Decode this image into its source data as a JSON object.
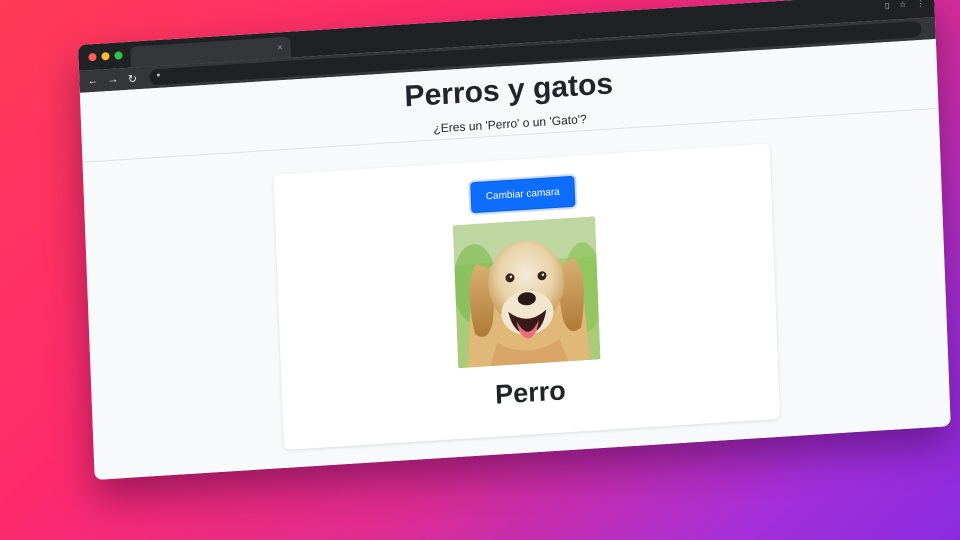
{
  "browser": {
    "tab_close": "×",
    "icons": [
      "back-arrow-icon",
      "forward-arrow-icon",
      "reload-icon",
      "lock-icon",
      "share-icon",
      "star-icon",
      "menu-dots-icon"
    ]
  },
  "page": {
    "title": "Perros y gatos",
    "subtitle": "¿Eres un 'Perro' o un 'Gato'?",
    "button_label": "Cambiar camara",
    "prediction": "Perro"
  },
  "colors": {
    "primary_button": "#0d6efd",
    "page_background": "#f8f9fa"
  }
}
